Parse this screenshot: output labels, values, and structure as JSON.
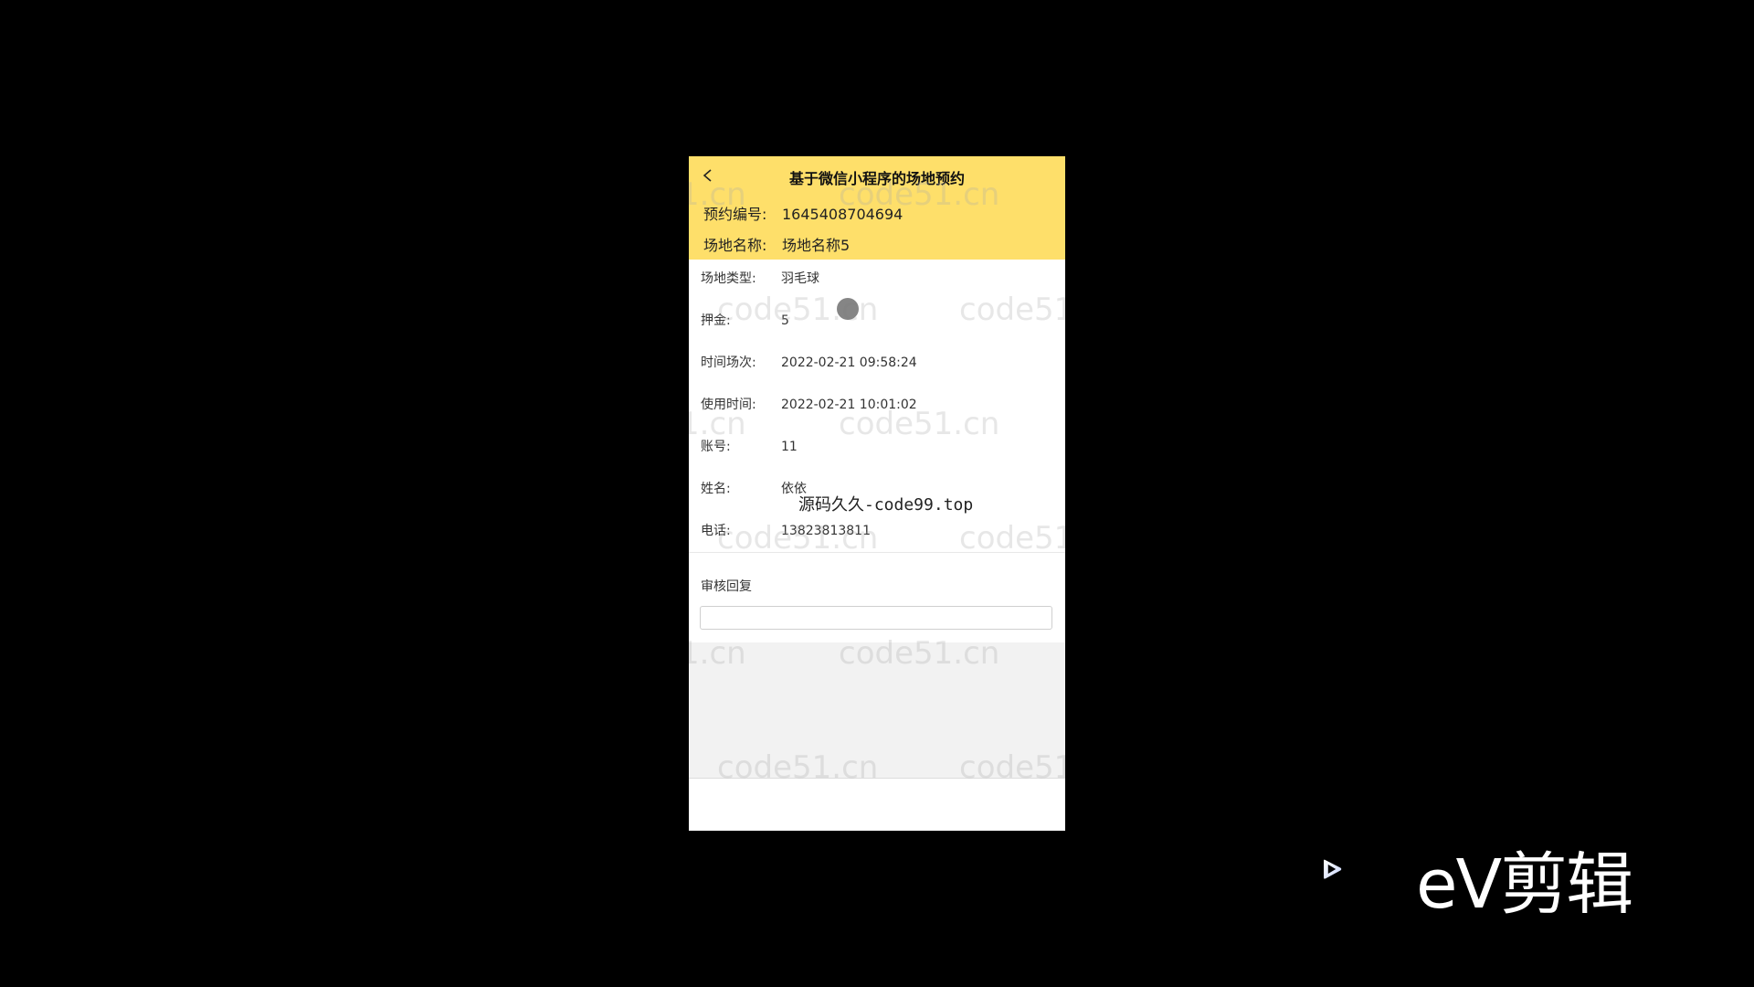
{
  "app": {
    "title": "基于微信小程序的场地预约"
  },
  "header": {
    "booking_no_label": "预约编号:",
    "booking_no_value": "1645408704694",
    "venue_name_label": "场地名称:",
    "venue_name_value": "场地名称5"
  },
  "details": [
    {
      "label": "场地类型:",
      "value": "羽毛球"
    },
    {
      "label": "押金:",
      "value": "5"
    },
    {
      "label": "时间场次:",
      "value": "2022-02-21 09:58:24"
    },
    {
      "label": "使用时间:",
      "value": "2022-02-21 10:01:02"
    },
    {
      "label": "账号:",
      "value": "11"
    },
    {
      "label": "姓名:",
      "value": "依依"
    },
    {
      "label": "电话:",
      "value": "13823813811"
    }
  ],
  "review": {
    "label": "审核回复",
    "input_value": ""
  },
  "watermarks": {
    "code51": "code51.cn",
    "code51_partial_left": "1.cn",
    "code51_partial_right": "code51"
  },
  "overlay": {
    "text": "源码久久-code99.top"
  },
  "brand": {
    "ev_text": "eV剪辑"
  },
  "colors": {
    "header_yellow": "#fedf6a",
    "background": "#000000",
    "gray_area": "#f2f2f2"
  },
  "icons": {
    "back": "chevron-left-icon",
    "ev_logo": "play-triangle-icon"
  }
}
